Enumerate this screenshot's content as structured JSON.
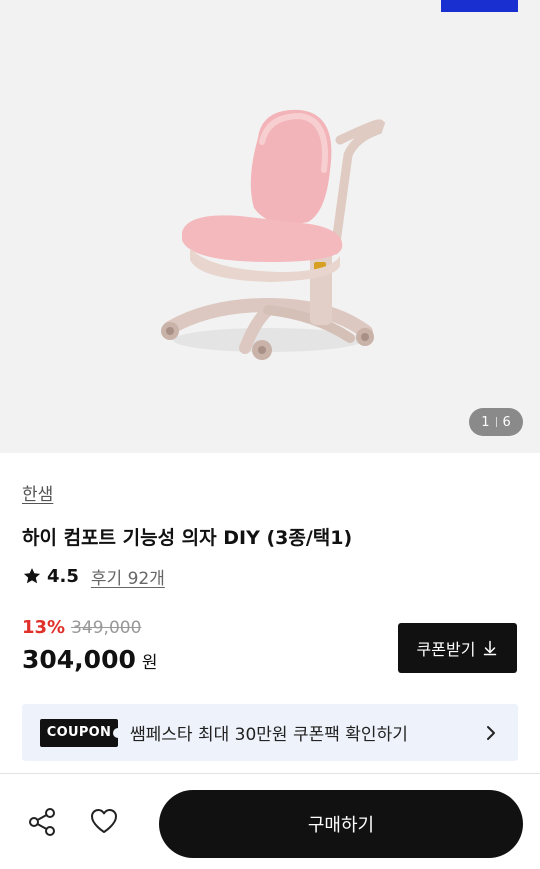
{
  "image": {
    "pager_current": "1",
    "pager_total": "6"
  },
  "product": {
    "brand": "한샘",
    "title": "하이 컴포트 기능성 의자 DIY (3종/택1)",
    "rating": "4.5",
    "reviews": "후기 92개",
    "discount": "13%",
    "original_price": "349,000",
    "price": "304,000",
    "currency": "원"
  },
  "coupon_button": {
    "label": "쿠폰받기"
  },
  "banner": {
    "tag": "COUPON",
    "text": "쌤페스타 최대 30만원 쿠폰팩 확인하기"
  },
  "bottom_bar": {
    "buy_label": "구매하기"
  },
  "colors": {
    "accent_blue": "#1a2fd0",
    "discount_red": "#e0302a",
    "chair_pink": "#f2b4b8",
    "banner_bg": "#eef3fb"
  },
  "icons": [
    "star-icon",
    "download-icon",
    "chevron-right-icon",
    "share-icon",
    "heart-icon"
  ]
}
